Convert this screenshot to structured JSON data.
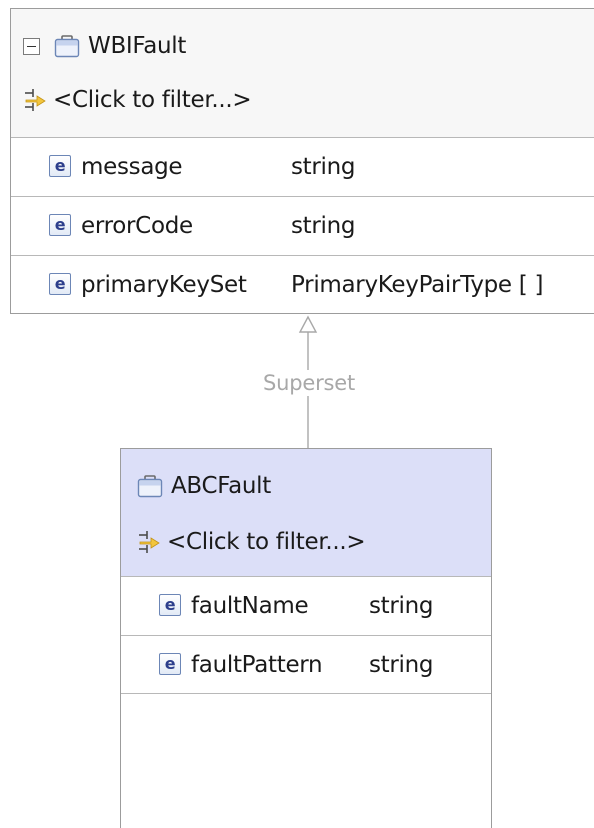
{
  "parent_bo": {
    "name": "WBIFault",
    "filter_text": "<Click to filter...>",
    "attributes": [
      {
        "icon": "e",
        "name": "message",
        "type": "string"
      },
      {
        "icon": "e",
        "name": "errorCode",
        "type": "string"
      },
      {
        "icon": "e",
        "name": "primaryKeySet",
        "type": "PrimaryKeyPairType [ ]"
      }
    ]
  },
  "relationship": {
    "label": "Superset"
  },
  "child_bo": {
    "name": "ABCFault",
    "filter_text": "<Click to filter...>",
    "attributes": [
      {
        "icon": "e",
        "name": "faultName",
        "type": "string"
      },
      {
        "icon": "e",
        "name": "faultPattern",
        "type": "string"
      }
    ]
  },
  "colors": {
    "child_header_bg": "#dcdff8",
    "parent_header_bg": "#f7f7f7",
    "border": "#9c9c9c",
    "connector": "#a8a8a8",
    "element_icon": "#2d3f8c"
  }
}
